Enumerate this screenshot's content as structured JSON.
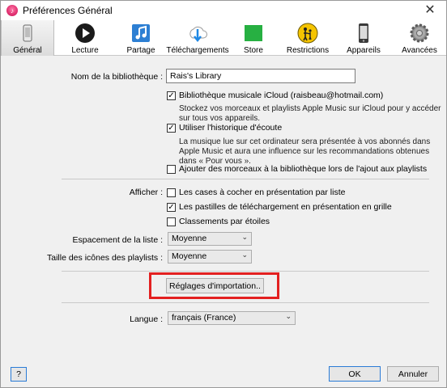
{
  "window": {
    "title": "Préférences Général"
  },
  "toolbar": {
    "tabs": [
      {
        "label": "Général",
        "icon": "phone-icon"
      },
      {
        "label": "Lecture",
        "icon": "play-icon"
      },
      {
        "label": "Partage",
        "icon": "music-note-icon"
      },
      {
        "label": "Téléchargements",
        "icon": "download-icon"
      },
      {
        "label": "Store",
        "icon": "store-icon"
      },
      {
        "label": "Restrictions",
        "icon": "parental-icon"
      },
      {
        "label": "Appareils",
        "icon": "device-icon"
      },
      {
        "label": "Avancées",
        "icon": "gear-icon"
      }
    ]
  },
  "general": {
    "library_name_label": "Nom de la bibliothèque :",
    "library_name_value": "Rais's Library",
    "icloud_label": "Bibliothèque musicale iCloud (raisbeau@hotmail.com)",
    "icloud_checked": true,
    "icloud_desc_1": "Stockez vos morceaux et playlists Apple Music sur iCloud pour y accéder",
    "icloud_desc_2": "sur tous vos appareils.",
    "history_label": "Utiliser l'historique d'écoute",
    "history_checked": true,
    "history_desc_1": "La musique lue sur cet ordinateur sera présentée à vos abonnés dans",
    "history_desc_2": "Apple Music et aura une influence sur les recommandations obtenues",
    "history_desc_3": "dans « Pour vous ».",
    "add_to_library_label": "Ajouter des morceaux à la bibliothèque lors de l'ajout aux playlists",
    "add_to_library_checked": false
  },
  "display": {
    "show_label": "Afficher :",
    "list_checkboxes_label": "Les cases à cocher en présentation par liste",
    "list_checkboxes_checked": false,
    "download_badges_label": "Les pastilles de téléchargement en présentation en grille",
    "download_badges_checked": true,
    "star_ratings_label": "Classements par étoiles",
    "star_ratings_checked": false,
    "list_spacing_label": "Espacement de la liste :",
    "list_spacing_value": "Moyenne",
    "playlist_icon_size_label": "Taille des icônes des playlists :",
    "playlist_icon_size_value": "Moyenne"
  },
  "import": {
    "button_label": "Réglages d'importation..",
    "highlight_color": "#e32020"
  },
  "language": {
    "label": "Langue :",
    "value": "français (France)"
  },
  "footer": {
    "help_label": "?",
    "ok_label": "OK",
    "cancel_label": "Annuler"
  }
}
